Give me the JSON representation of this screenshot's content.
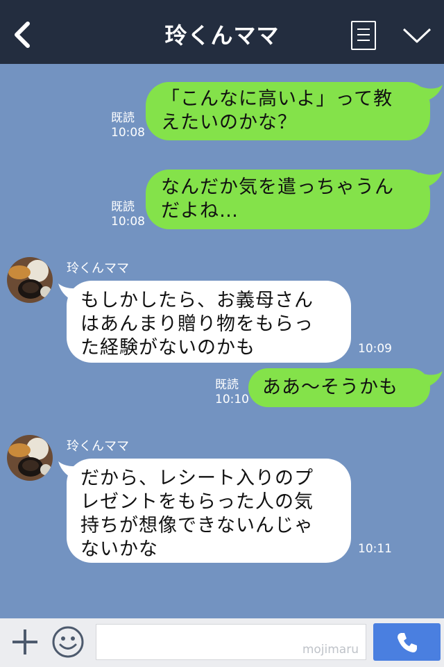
{
  "header": {
    "title": "玲くんママ"
  },
  "messages": [
    {
      "sender": "me",
      "lines": [
        "「こんなに高いよ」って教",
        "えたいのかな？"
      ],
      "read": "既読",
      "time": "10:08"
    },
    {
      "sender": "me",
      "lines": [
        "なんだか気を遣っちゃうん",
        "だよね…"
      ],
      "read": "既読",
      "time": "10:08"
    },
    {
      "sender": "other",
      "name": "玲くんママ",
      "lines": [
        "もしかしたら、お義母さん",
        "はあんまり贈り物をもらっ",
        "た経験がないのかも"
      ],
      "time": "10:09"
    },
    {
      "sender": "me",
      "lines": [
        "ああ〜そうかも"
      ],
      "read": "既読",
      "time": "10:10"
    },
    {
      "sender": "other",
      "name": "玲くんママ",
      "lines": [
        "だから、レシート入りのプ",
        "レゼントをもらった人の気",
        "持ちが想像できないんじゃ",
        "ないかな"
      ],
      "time": "10:11"
    }
  ],
  "input": {
    "value": "",
    "watermark": "mojimaru"
  },
  "colors": {
    "header_bg": "#232d3f",
    "chat_bg": "#7393c1",
    "my_bubble": "#84e24a",
    "their_bubble": "#ffffff",
    "call_button": "#4a7fe0"
  },
  "icons": [
    "back-chevron-icon",
    "menu-list-icon",
    "collapse-chevron-icon",
    "plus-icon",
    "emoji-icon",
    "phone-icon"
  ]
}
